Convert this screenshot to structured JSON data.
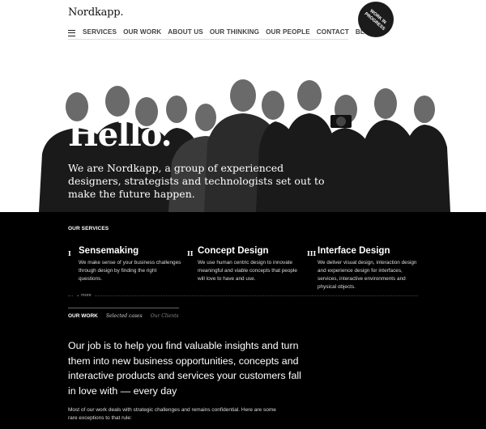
{
  "header": {
    "logo": "Nordkapp.",
    "menu_icon": "hamburger-icon",
    "nav": [
      "SERVICES",
      "OUR WORK",
      "ABOUT US",
      "OUR THINKING",
      "OUR PEOPLE",
      "CONTACT",
      "BLOG"
    ],
    "badge": "WORK IN PROGRESS"
  },
  "hero": {
    "headline": "Hello.",
    "intro": "We are Nordkapp, a group of experienced designers, strategists and technologists set out to make the future happen."
  },
  "services": {
    "label": "OUR SERVICES",
    "items": [
      {
        "num": "I",
        "title": "Sensemaking",
        "text": "We make sense of your business challenges through design by finding the right questions."
      },
      {
        "num": "II",
        "title": "Concept Design",
        "text": "We use human centric design to innovate meaningful and viable concepts that people will love to have and use."
      },
      {
        "num": "III",
        "title": "Interface Design",
        "text": "We deliver visual design, interaction design and experience design for interfaces, services, interactive environments and physical objects."
      }
    ],
    "more": "more"
  },
  "work": {
    "label": "OUR WORK",
    "tabs": [
      "Selected cases",
      "Our Clients"
    ],
    "statement": "Our job is to help you find valuable insights and turn them into new business opportunities, concepts and interactive products and services your customers fall in love with — every day",
    "note": "Most of our work deals with strategic challenges and remains confidential. Here are some rare exceptions to that rule:"
  }
}
